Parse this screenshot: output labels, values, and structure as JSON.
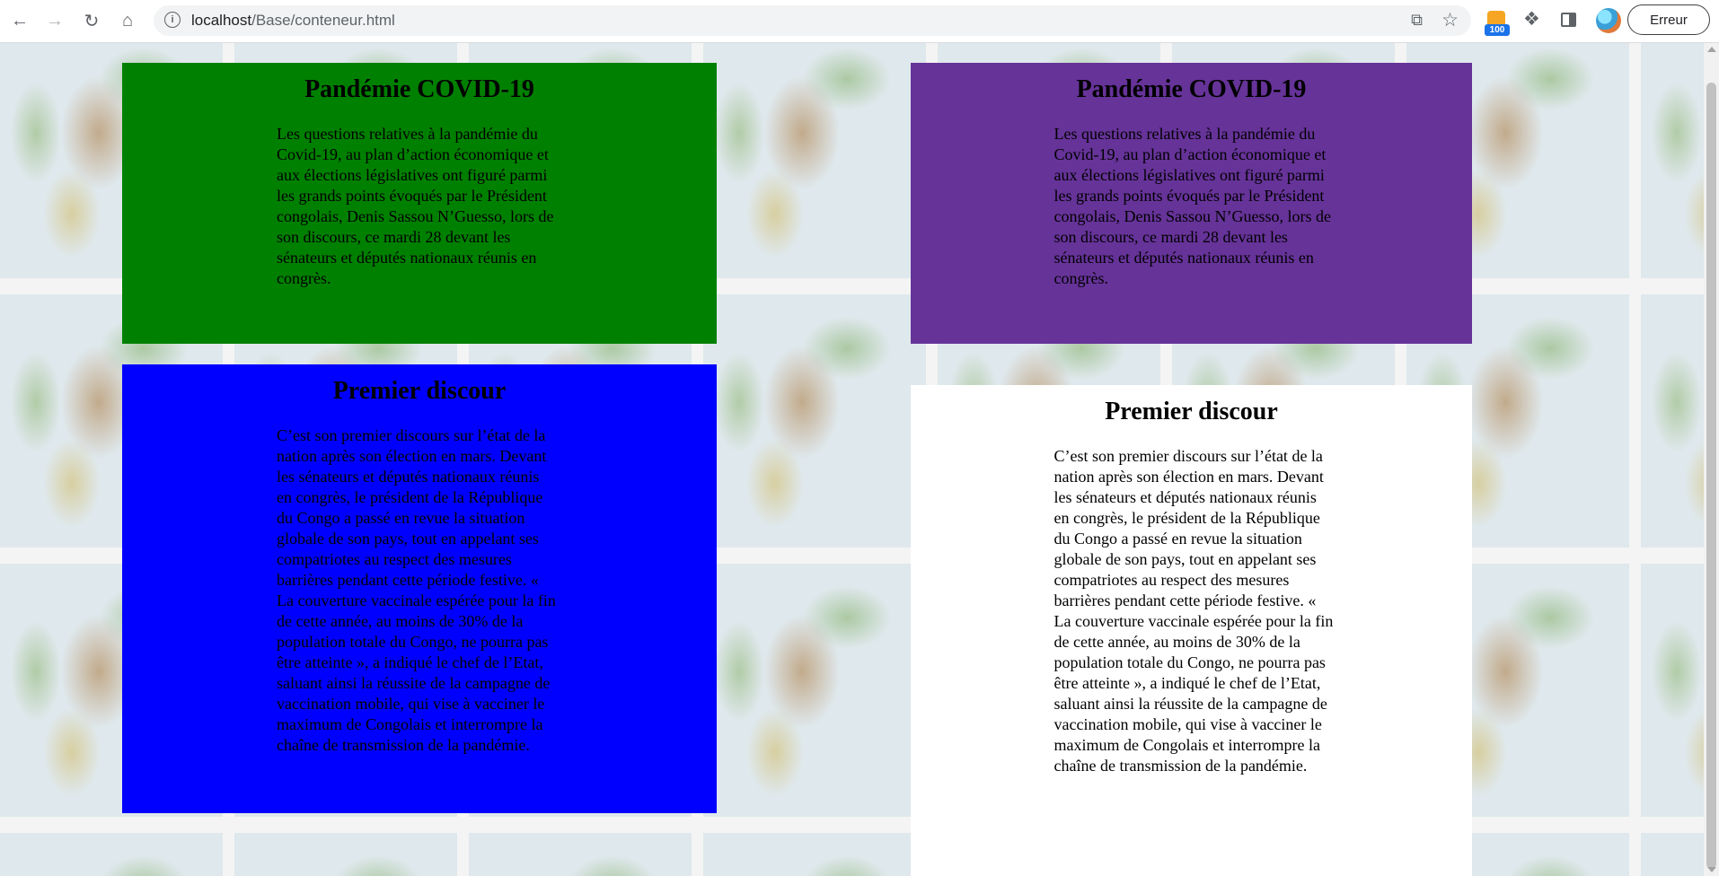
{
  "browser": {
    "url_host": "localhost",
    "url_path": "/Base/conteneur.html",
    "extension_badge": "100",
    "profile_label": "Erreur"
  },
  "boxes": [
    {
      "id": "green",
      "color": "#008000",
      "title": "Pandémie COVID-19",
      "text": "Les questions relatives à la pandémie du Covid-19, au plan d’action économique et aux élections législatives ont figuré parmi les grands points évoqués par le Président congolais, Denis Sassou N’Guesso, lors de son discours, ce mardi 28 devant les sénateurs et députés nationaux réunis en congrès."
    },
    {
      "id": "purple",
      "color": "#663399",
      "title": "Pandémie COVID-19",
      "text": "Les questions relatives à la pandémie du Covid-19, au plan d’action économique et aux élections législatives ont figuré parmi les grands points évoqués par le Président congolais, Denis Sassou N’Guesso, lors de son discours, ce mardi 28 devant les sénateurs et députés nationaux réunis en congrès."
    },
    {
      "id": "blue",
      "color": "#0000ff",
      "title": "Premier discour",
      "text": "C’est son premier discours sur l’état de la nation après son élection en mars. Devant les sénateurs et députés nationaux réunis en congrès, le président de la République du Congo a passé en revue la situation globale de son pays, tout en appelant ses compatriotes au respect des mesures barrières pendant cette période festive. « La couverture vaccinale espérée pour la fin de cette année, au moins de 30% de la population totale du Congo, ne pourra pas être atteinte », a indiqué le chef de l’Etat, saluant ainsi la réussite de la campagne de vaccination mobile, qui vise à vacciner le maximum de Congolais et interrompre la chaîne de transmission de la pandémie."
    },
    {
      "id": "white",
      "color": "#ffffff",
      "title": "Premier discour",
      "text": "C’est son premier discours sur l’état de la nation après son élection en mars. Devant les sénateurs et députés nationaux réunis en congrès, le président de la République du Congo a passé en revue la situation globale de son pays, tout en appelant ses compatriotes au respect des mesures barrières pendant cette période festive. « La couverture vaccinale espérée pour la fin de cette année, au moins de 30% de la population totale du Congo, ne pourra pas être atteinte », a indiqué le chef de l’Etat, saluant ainsi la réussite de la campagne de vaccination mobile, qui vise à vacciner le maximum de Congolais et interrompre la chaîne de transmission de la pandémie."
    }
  ]
}
